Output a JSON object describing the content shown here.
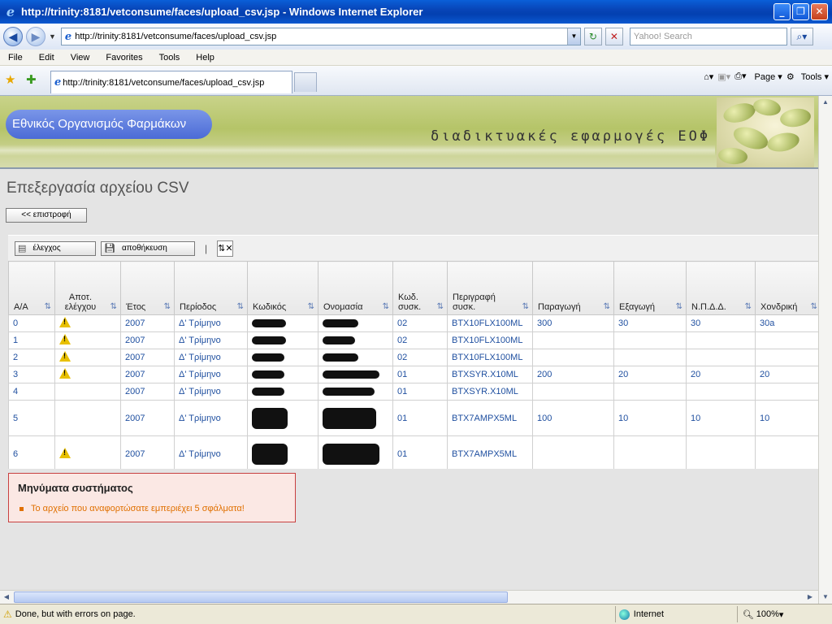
{
  "window": {
    "title": "http://trinity:8181/vetconsume/faces/upload_csv.jsp - Windows Internet Explorer"
  },
  "address_bar": {
    "url": "http://trinity:8181/vetconsume/faces/upload_csv.jsp",
    "search_placeholder": "Yahoo! Search"
  },
  "menu": [
    "File",
    "Edit",
    "View",
    "Favorites",
    "Tools",
    "Help"
  ],
  "tab": {
    "label": "http://trinity:8181/vetconsume/faces/upload_csv.jsp"
  },
  "command_bar": {
    "page_label": "Page",
    "tools_label": "Tools"
  },
  "banner": {
    "org_name": "Εθνικός Οργανισμός Φαρμάκων",
    "slogan": "διαδικτυακές εφαρμογές ΕΟΦ"
  },
  "page": {
    "title": "Επεξεργασία αρχείου CSV",
    "back_button": "<< επιστροφή"
  },
  "toolbar": {
    "check_button": "έλεγχος",
    "save_button": "αποθήκευση"
  },
  "table": {
    "columns": [
      "Α/Α",
      "Αποτ. ελέγχου",
      "Έτος",
      "Περίοδος",
      "Κωδικός",
      "Ονομασία",
      "Κωδ. συσκ.",
      "Περιγραφή συσκ.",
      "Παραγωγή",
      "Εξαγωγή",
      "Ν.Π.Δ.Δ.",
      "Χονδρική"
    ],
    "rows": [
      {
        "aa": "0",
        "warning": true,
        "year": "2007",
        "period": "Δ' Τρίμηνο",
        "code_pkg": "02",
        "pkg_desc": "BTX10FLX100ML",
        "production": "300",
        "export": "30",
        "npdd": "30",
        "wholesale": "30a"
      },
      {
        "aa": "1",
        "warning": true,
        "year": "2007",
        "period": "Δ' Τρίμηνο",
        "code_pkg": "02",
        "pkg_desc": "BTX10FLX100ML",
        "production": "",
        "export": "",
        "npdd": "",
        "wholesale": ""
      },
      {
        "aa": "2",
        "warning": true,
        "year": "2007",
        "period": "Δ' Τρίμηνο",
        "code_pkg": "02",
        "pkg_desc": "BTX10FLX100ML",
        "production": "",
        "export": "",
        "npdd": "",
        "wholesale": ""
      },
      {
        "aa": "3",
        "warning": true,
        "year": "2007",
        "period": "Δ' Τρίμηνο",
        "code_pkg": "01",
        "pkg_desc": "BTXSYR.X10ML",
        "production": "200",
        "export": "20",
        "npdd": "20",
        "wholesale": "20"
      },
      {
        "aa": "4",
        "warning": false,
        "year": "2007",
        "period": "Δ' Τρίμηνο",
        "code_pkg": "01",
        "pkg_desc": "BTXSYR.X10ML",
        "production": "",
        "export": "",
        "npdd": "",
        "wholesale": ""
      },
      {
        "aa": "5",
        "warning": false,
        "year": "2007",
        "period": "Δ' Τρίμηνο",
        "code_pkg": "01",
        "pkg_desc": "BTX7AMPX5ML",
        "production": "100",
        "export": "10",
        "npdd": "10",
        "wholesale": "10"
      },
      {
        "aa": "6",
        "warning": true,
        "year": "2007",
        "period": "Δ' Τρίμηνο",
        "code_pkg": "01",
        "pkg_desc": "BTX7AMPX5ML",
        "production": "",
        "export": "",
        "npdd": "",
        "wholesale": ""
      }
    ]
  },
  "messages": {
    "title": "Μηνύματα συστήματος",
    "items": [
      "Το αρχείο που αναφορτώσατε εμπεριέχει 5 σφάλματα!"
    ]
  },
  "status": {
    "text": "Done, but with errors on page.",
    "zone": "Internet",
    "zoom": "100%"
  }
}
